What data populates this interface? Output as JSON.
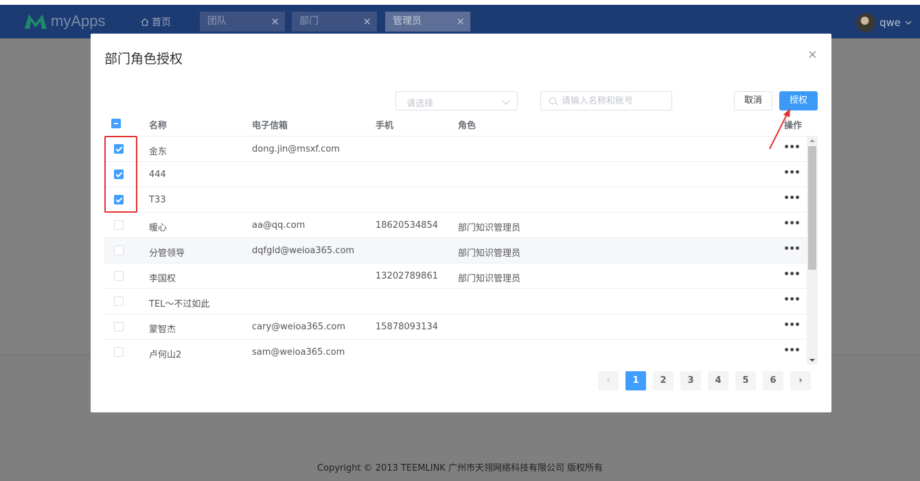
{
  "app": {
    "name": "myApps"
  },
  "nav": {
    "home": "首页",
    "tabs": [
      {
        "label": "团队"
      },
      {
        "label": "部门"
      },
      {
        "label": "管理员"
      }
    ],
    "close_glyph": "×",
    "user": "qwe"
  },
  "dialog": {
    "title": "部门角色授权",
    "close_glyph": "×",
    "select_placeholder": "请选择",
    "search_placeholder": "请输入名称和账号",
    "cancel": "取消",
    "authorize": "授权",
    "columns": [
      "名称",
      "电子信箱",
      "手机",
      "角色",
      "操作"
    ],
    "rows": [
      {
        "name": "金东",
        "email": "dong.jin@msxf.com",
        "phone": "",
        "role": "",
        "checked": true
      },
      {
        "name": "444",
        "email": "",
        "phone": "",
        "role": "",
        "checked": true
      },
      {
        "name": "T33",
        "email": "",
        "phone": "",
        "role": "",
        "checked": true
      },
      {
        "name": "暖心",
        "email": "aa@qq.com",
        "phone": "18620534854",
        "role": "部门知识管理员",
        "checked": false
      },
      {
        "name": "分管领导",
        "email": "dqfgld@weioa365.com",
        "phone": "",
        "role": "部门知识管理员",
        "checked": false
      },
      {
        "name": "李国权",
        "email": "",
        "phone": "13202789861",
        "role": "部门知识管理员",
        "checked": false
      },
      {
        "name": "TEL～不过如此",
        "email": "",
        "phone": "",
        "role": "",
        "checked": false
      },
      {
        "name": "蒙智杰",
        "email": "cary@weioa365.com",
        "phone": "15878093134",
        "role": "",
        "checked": false
      },
      {
        "name": "卢何山2",
        "email": "sam@weioa365.com",
        "phone": "",
        "role": "",
        "checked": false
      }
    ],
    "row_action": "•••",
    "pager": {
      "prev": "‹",
      "next": "›",
      "pages": [
        "1",
        "2",
        "3",
        "4",
        "5",
        "6"
      ],
      "current": "1"
    }
  },
  "footer": "Copyright © 2013 TEEMLINK 广州市天翎网络科技有限公司 版权所有",
  "colors": {
    "primary": "#409eff",
    "header": "#1d3b73",
    "highlight": "#e53030"
  }
}
